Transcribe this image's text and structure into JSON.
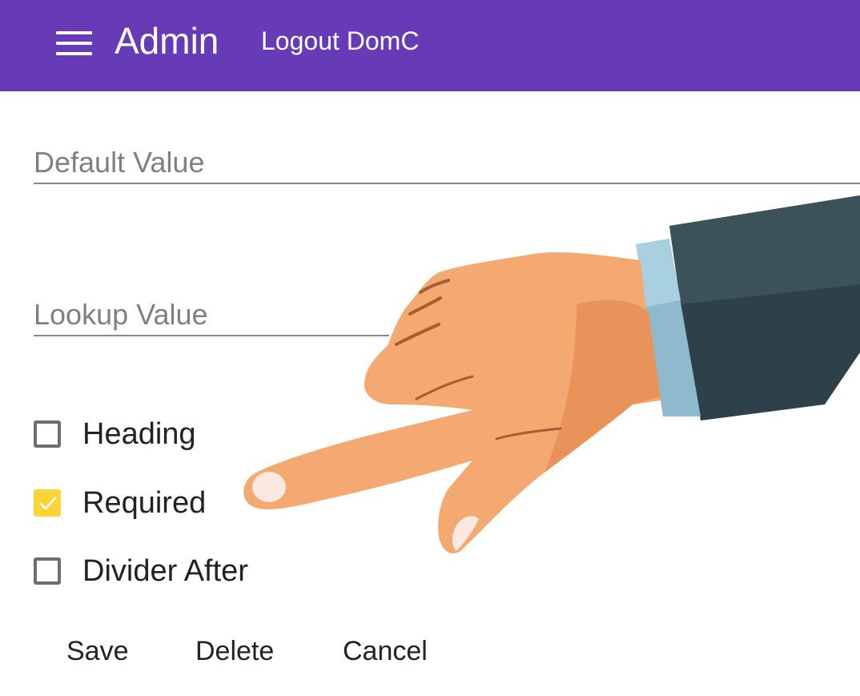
{
  "header": {
    "title": "Admin",
    "logout_label": "Logout DomC",
    "background_color": "#673ab7"
  },
  "fields": {
    "default_value": {
      "placeholder": "Default Value",
      "value": ""
    },
    "lookup_value": {
      "placeholder": "Lookup Value",
      "value": ""
    }
  },
  "checkboxes": {
    "heading": {
      "label": "Heading",
      "checked": false
    },
    "required": {
      "label": "Required",
      "checked": true
    },
    "divider_after": {
      "label": "Divider After",
      "checked": false
    }
  },
  "checkbox_checked_color": "#fbd437",
  "actions": {
    "save_label": "Save",
    "delete_label": "Delete",
    "cancel_label": "Cancel"
  },
  "illustration": {
    "icon": "pointing-hand-icon"
  }
}
